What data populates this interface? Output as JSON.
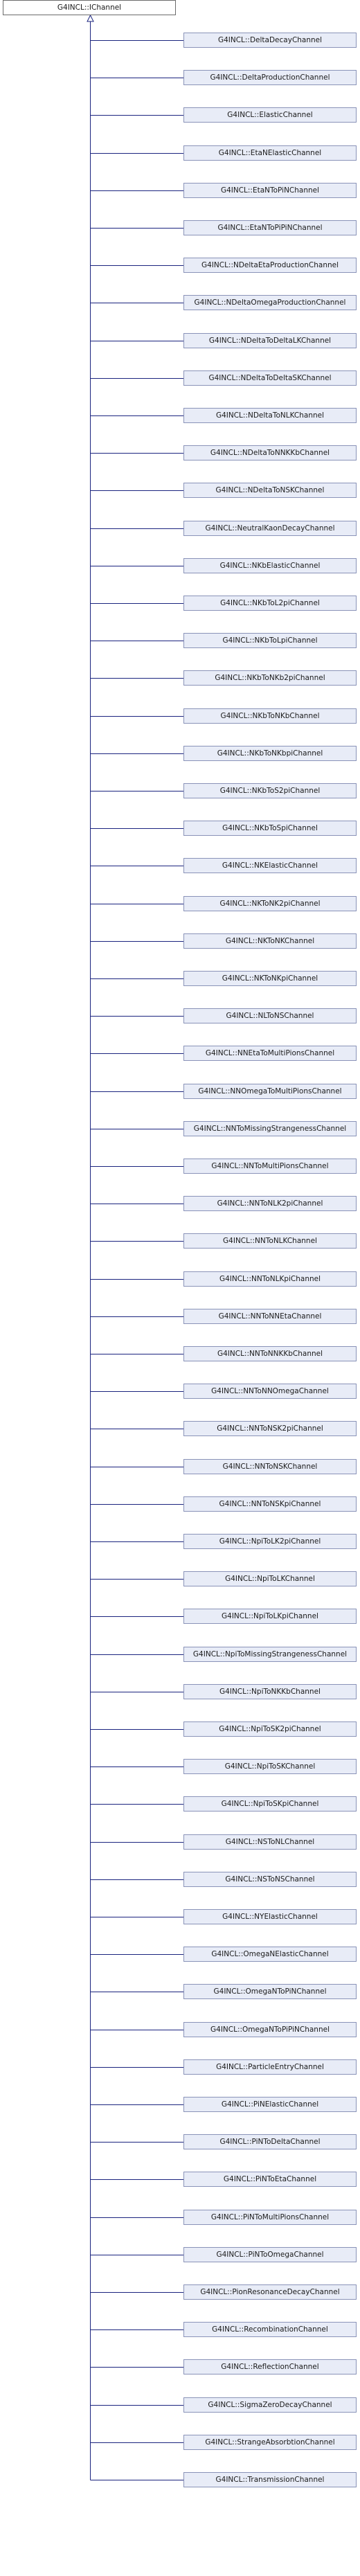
{
  "base_class": "G4INCL::IChannel",
  "derived_classes": [
    "G4INCL::DeltaDecayChannel",
    "G4INCL::DeltaProductionChannel",
    "G4INCL::ElasticChannel",
    "G4INCL::EtaNElasticChannel",
    "G4INCL::EtaNToPiNChannel",
    "G4INCL::EtaNToPiPiNChannel",
    "G4INCL::NDeltaEtaProductionChannel",
    "G4INCL::NDeltaOmegaProductionChannel",
    "G4INCL::NDeltaToDeltaLKChannel",
    "G4INCL::NDeltaToDeltaSKChannel",
    "G4INCL::NDeltaToNLKChannel",
    "G4INCL::NDeltaToNNKKbChannel",
    "G4INCL::NDeltaToNSKChannel",
    "G4INCL::NeutralKaonDecayChannel",
    "G4INCL::NKbElasticChannel",
    "G4INCL::NKbToL2piChannel",
    "G4INCL::NKbToLpiChannel",
    "G4INCL::NKbToNKb2piChannel",
    "G4INCL::NKbToNKbChannel",
    "G4INCL::NKbToNKbpiChannel",
    "G4INCL::NKbToS2piChannel",
    "G4INCL::NKbToSpiChannel",
    "G4INCL::NKElasticChannel",
    "G4INCL::NKToNK2piChannel",
    "G4INCL::NKToNKChannel",
    "G4INCL::NKToNKpiChannel",
    "G4INCL::NLToNSChannel",
    "G4INCL::NNEtaToMultiPionsChannel",
    "G4INCL::NNOmegaToMultiPionsChannel",
    "G4INCL::NNToMissingStrangenessChannel",
    "G4INCL::NNToMultiPionsChannel",
    "G4INCL::NNToNLK2piChannel",
    "G4INCL::NNToNLKChannel",
    "G4INCL::NNToNLKpiChannel",
    "G4INCL::NNToNNEtaChannel",
    "G4INCL::NNToNNKKbChannel",
    "G4INCL::NNToNNOmegaChannel",
    "G4INCL::NNToNSK2piChannel",
    "G4INCL::NNToNSKChannel",
    "G4INCL::NNToNSKpiChannel",
    "G4INCL::NpiToLK2piChannel",
    "G4INCL::NpiToLKChannel",
    "G4INCL::NpiToLKpiChannel",
    "G4INCL::NpiToMissingStrangenessChannel",
    "G4INCL::NpiToNKKbChannel",
    "G4INCL::NpiToSK2piChannel",
    "G4INCL::NpiToSKChannel",
    "G4INCL::NpiToSKpiChannel",
    "G4INCL::NSToNLChannel",
    "G4INCL::NSToNSChannel",
    "G4INCL::NYElasticChannel",
    "G4INCL::OmegaNElasticChannel",
    "G4INCL::OmegaNToPiNChannel",
    "G4INCL::OmegaNToPiPiNChannel",
    "G4INCL::ParticleEntryChannel",
    "G4INCL::PiNElasticChannel",
    "G4INCL::PiNToDeltaChannel",
    "G4INCL::PiNToEtaChannel",
    "G4INCL::PiNToMultiPionsChannel",
    "G4INCL::PiNToOmegaChannel",
    "G4INCL::PionResonanceDecayChannel",
    "G4INCL::RecombinationChannel",
    "G4INCL::ReflectionChannel",
    "G4INCL::SigmaZeroDecayChannel",
    "G4INCL::StrangeAbsorbtionChannel",
    "G4INCL::TransmissionChannel"
  ],
  "colors": {
    "node_fill": "#e8ecf7",
    "node_border": "#8a93b8",
    "base_fill": "#ffffff",
    "base_border": "#6b6b6b",
    "edge": "#1a237e"
  }
}
